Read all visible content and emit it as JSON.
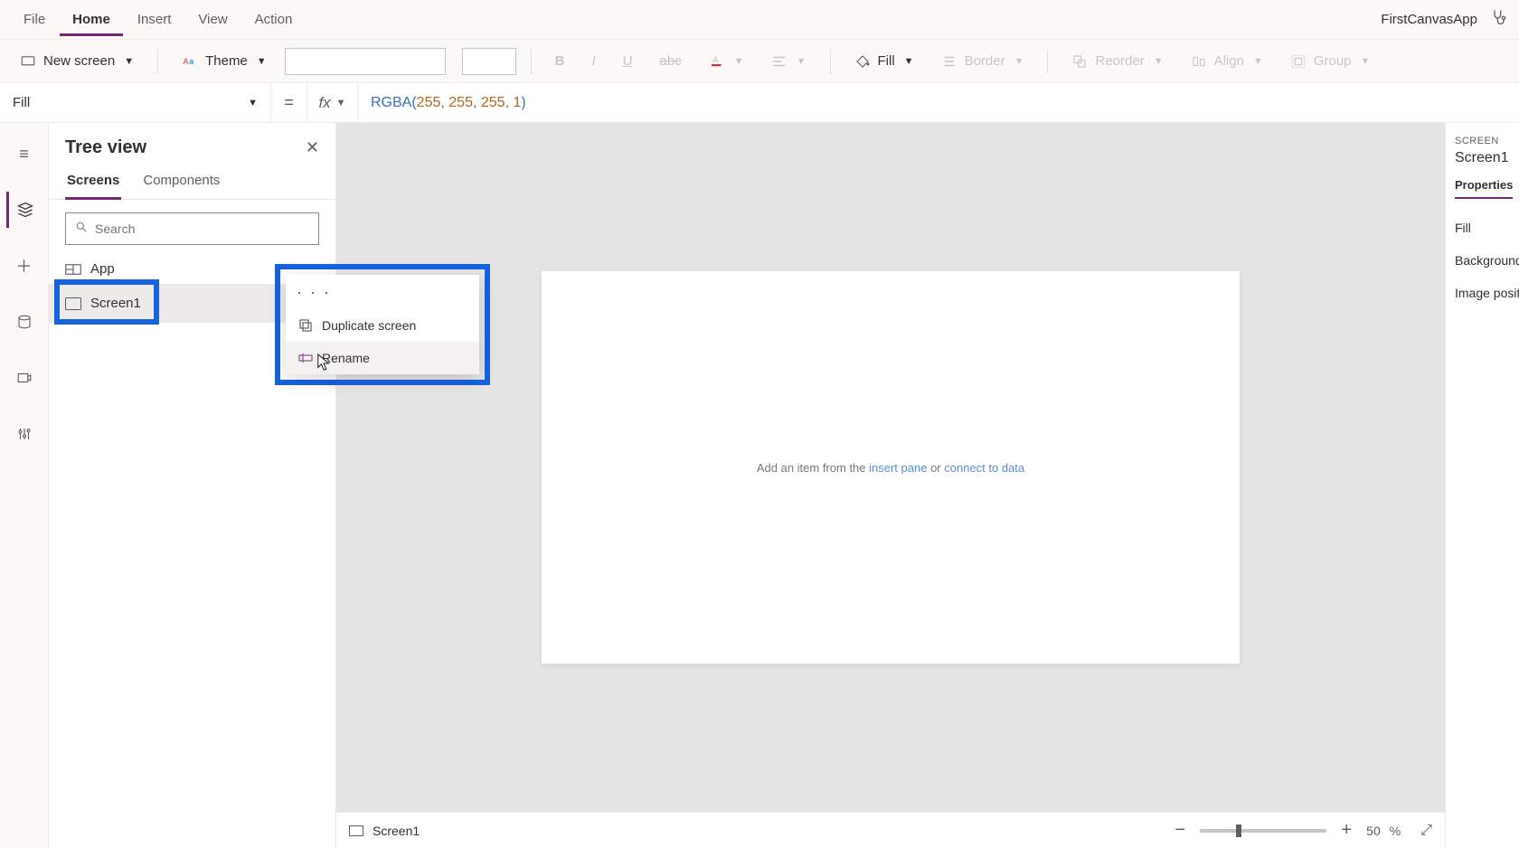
{
  "menubar": {
    "items": [
      "File",
      "Home",
      "Insert",
      "View",
      "Action"
    ],
    "active": "Home",
    "app_title": "FirstCanvasApp"
  },
  "ribbon": {
    "new_screen": "New screen",
    "theme": "Theme",
    "fill": "Fill",
    "border": "Border",
    "reorder": "Reorder",
    "align": "Align",
    "group": "Group"
  },
  "formula_bar": {
    "property": "Fill",
    "equals": "=",
    "fx": "fx",
    "formula_fn": "RGBA",
    "formula_args": [
      "255",
      "255",
      "255",
      "1"
    ]
  },
  "tree": {
    "title": "Tree view",
    "tabs": {
      "screens": "Screens",
      "components": "Components"
    },
    "search_placeholder": "Search",
    "items": {
      "app": "App",
      "screen1": "Screen1"
    }
  },
  "context_menu": {
    "duplicate": "Duplicate screen",
    "rename": "Rename"
  },
  "canvas": {
    "hint_prefix": "Add an item from the ",
    "hint_link1": "insert pane",
    "hint_mid": " or ",
    "hint_link2": "connect to data"
  },
  "footer": {
    "screen_name": "Screen1",
    "zoom_value": "50",
    "zoom_pct": "%"
  },
  "right_panel": {
    "header_label": "SCREEN",
    "name": "Screen1",
    "tab": "Properties",
    "rows": {
      "fill": "Fill",
      "bg": "Background",
      "imgpos": "Image posit"
    }
  }
}
